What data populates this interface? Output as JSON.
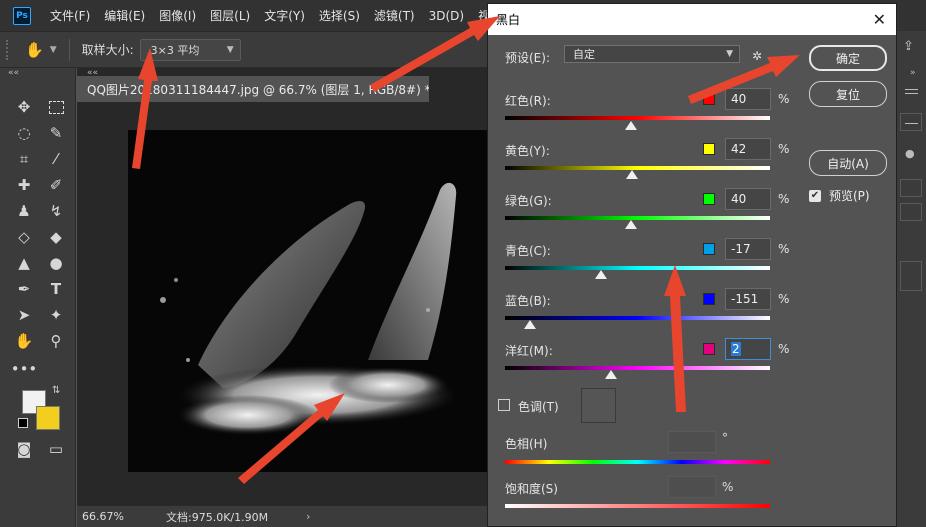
{
  "menubar": {
    "logo": "Ps",
    "items": [
      "文件(F)",
      "编辑(E)",
      "图像(I)",
      "图层(L)",
      "文字(Y)",
      "选择(S)",
      "滤镜(T)",
      "3D(D)",
      "视"
    ]
  },
  "options": {
    "sample_label": "取样大小:",
    "sample_value": "3×3 平均"
  },
  "document": {
    "tab_title": "QQ图片20180311184447.jpg @ 66.7% (图层 1, RGB/8#) *",
    "zoom": "66.67%",
    "doc_info": "文档:975.0K/1.90M"
  },
  "colors": {
    "foreground": "#f2f2f2",
    "background": "#f2cf1c",
    "arrow": "#e8452e"
  },
  "dialog": {
    "title": "黑白",
    "preset_label": "预设(E):",
    "preset_value": "自定",
    "ok": "确定",
    "reset": "复位",
    "auto": "自动(A)",
    "preview": "预览(P)",
    "percent": "%",
    "channels": [
      {
        "label": "红色(R):",
        "value": "40",
        "swatch": "#ff0000"
      },
      {
        "label": "黄色(Y):",
        "value": "42",
        "swatch": "#ffff00"
      },
      {
        "label": "绿色(G):",
        "value": "40",
        "swatch": "#00ff00"
      },
      {
        "label": "青色(C):",
        "value": "-17",
        "swatch": "#00a0e8"
      },
      {
        "label": "蓝色(B):",
        "value": "-151",
        "swatch": "#0000ff"
      },
      {
        "label": "洋红(M):",
        "value": "2",
        "swatch": "#e4007f"
      }
    ],
    "tint_label": "色调(T)",
    "hue_label": "色相(H)",
    "hue_unit": "°",
    "saturation_label": "饱和度(S)",
    "saturation_unit": "%"
  }
}
